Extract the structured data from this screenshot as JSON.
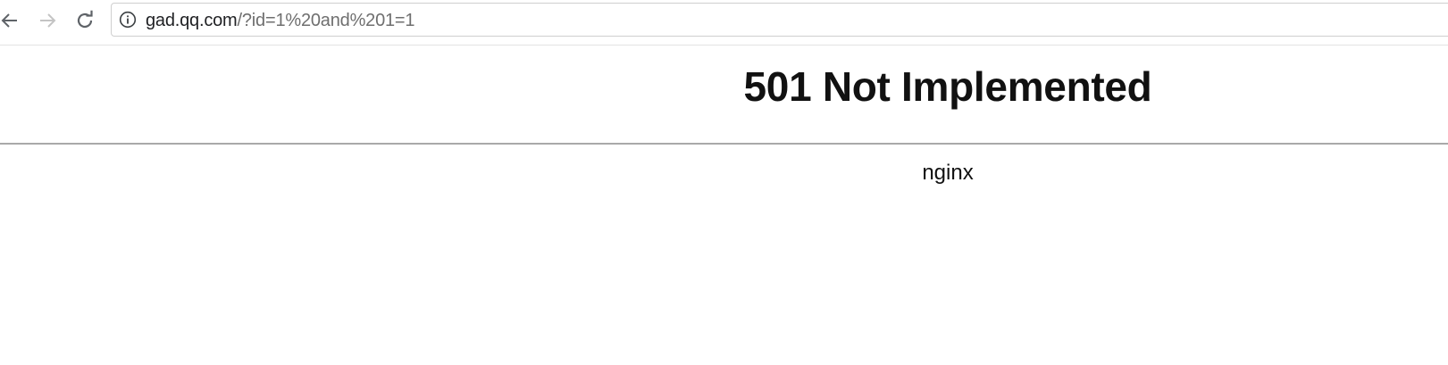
{
  "browser": {
    "nav": {
      "back_icon": "arrow-left-icon",
      "forward_icon": "arrow-right-icon",
      "reload_icon": "reload-icon"
    },
    "address_bar": {
      "icon": "info-icon",
      "host": "gad.qq.com",
      "path": "/?id=1%20and%201=1"
    }
  },
  "page": {
    "title": "501 Not Implemented",
    "server": "nginx"
  }
}
